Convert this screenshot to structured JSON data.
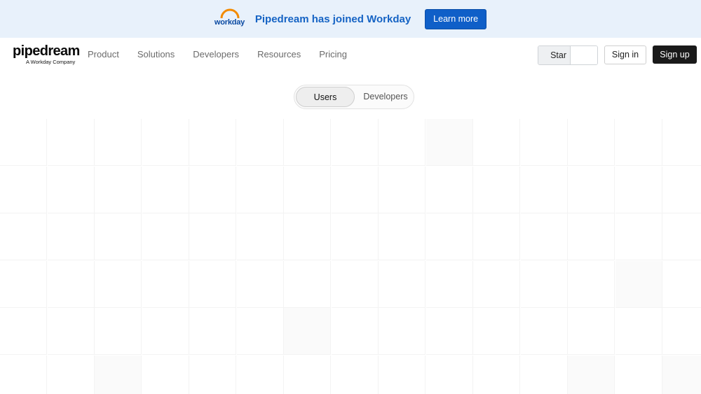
{
  "banner": {
    "logo_text": "workday",
    "title": "Pipedream has joined Workday",
    "button_label": "Learn more"
  },
  "header": {
    "logo": {
      "name": "pipedream",
      "tagline": "A Workday Company"
    },
    "nav": [
      "Product",
      "Solutions",
      "Developers",
      "Resources",
      "Pricing"
    ],
    "github_star_label": "Star",
    "sign_in_label": "Sign in",
    "sign_up_label": "Sign up"
  },
  "audience_toggle": {
    "options": [
      "Users",
      "Developers"
    ],
    "selected": "Users"
  },
  "colors": {
    "banner_bg": "#e8f1fb",
    "banner_title": "#1563c4",
    "primary_button": "#0f5fc8",
    "sign_up_bg": "#1a1a1a"
  }
}
